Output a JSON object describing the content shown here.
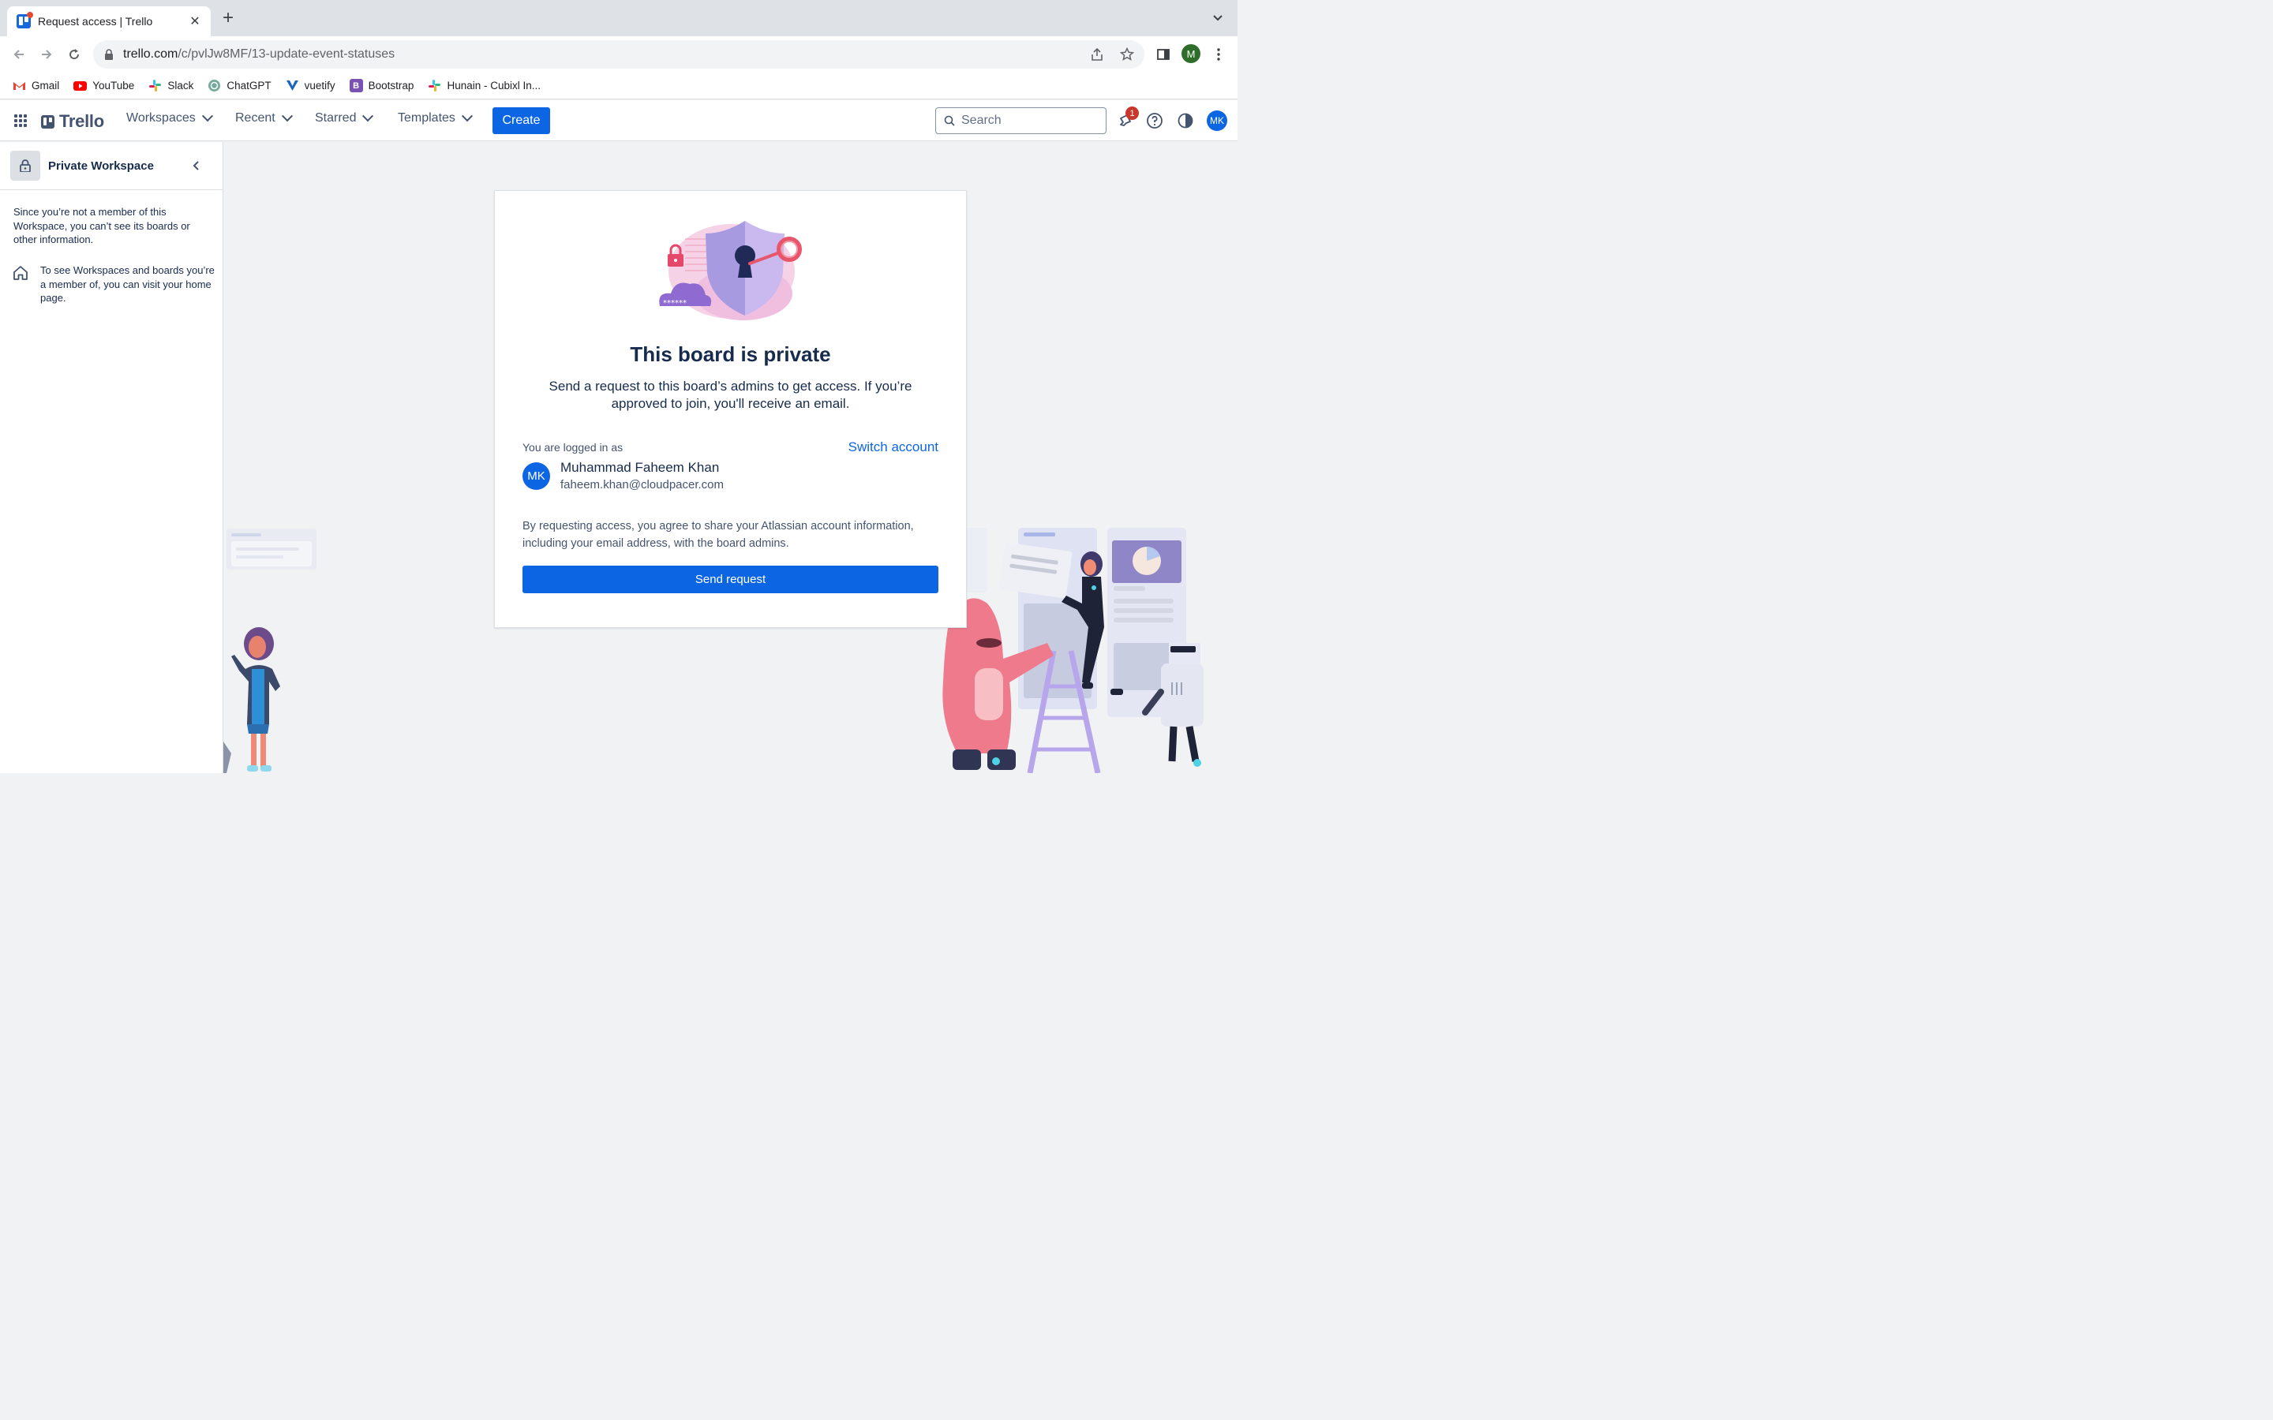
{
  "browser": {
    "tab_title": "Request access | Trello",
    "url_host": "trello.com",
    "url_path": "/c/pvlJw8MF/13-update-event-statuses",
    "profile_initial": "M",
    "bookmarks": [
      {
        "label": "Gmail",
        "icon": "gmail-icon"
      },
      {
        "label": "YouTube",
        "icon": "youtube-icon"
      },
      {
        "label": "Slack",
        "icon": "slack-icon"
      },
      {
        "label": "ChatGPT",
        "icon": "chatgpt-icon"
      },
      {
        "label": "vuetify",
        "icon": "vuetify-icon"
      },
      {
        "label": "Bootstrap",
        "icon": "bootstrap-icon"
      },
      {
        "label": "Hunain - Cubixl In...",
        "icon": "slack-icon"
      }
    ]
  },
  "header": {
    "logo": "Trello",
    "menu": [
      "Workspaces",
      "Recent",
      "Starred",
      "Templates"
    ],
    "create_label": "Create",
    "search_placeholder": "Search",
    "notification_count": "1",
    "avatar_initials": "MK"
  },
  "sidebar": {
    "workspace_title": "Private Workspace",
    "notice": "Since you’re not a member of this Workspace, you can’t see its boards or other information.",
    "home_hint": "To see Workspaces and boards you’re a member of, you can visit your home page."
  },
  "card": {
    "title": "This board is private",
    "description": "Send a request to this board’s admins to get access. If you’re approved to join, you'll receive an email.",
    "logged_in_label": "You are logged in as",
    "switch_account": "Switch account",
    "user_initials": "MK",
    "user_name": "Muhammad Faheem Khan",
    "user_email": "faheem.khan@cloudpacer.com",
    "consent": "By requesting access, you agree to share your Atlassian account information, including your email address, with the board admins.",
    "send_label": "Send request",
    "password_mask": "******"
  },
  "colors": {
    "brand_blue": "#0c66e4",
    "text_dark": "#172b4d",
    "text_subtle": "#44546f",
    "badge_red": "#c9372c"
  }
}
